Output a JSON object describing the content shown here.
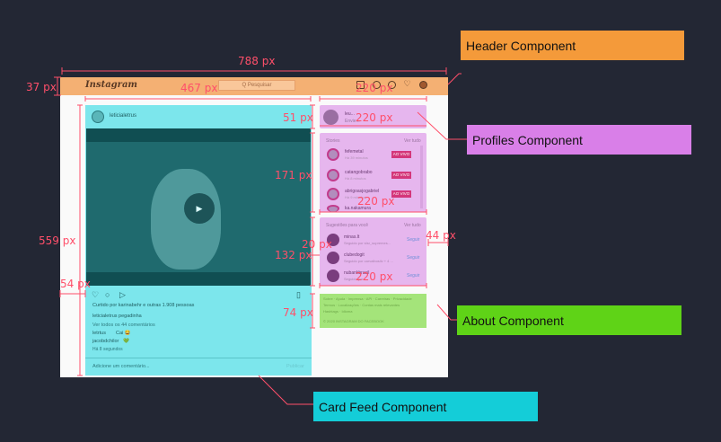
{
  "dimensions": {
    "page_width": "788 px",
    "header_height": "37 px",
    "feed_width": "467 px",
    "sidebar_width_header": "220 px",
    "profile_height": "51 px",
    "profile_width": "220 px",
    "stories_height": "171 px",
    "stories_width": "220 px",
    "page_height": "559 px",
    "feed_margin": "54 px",
    "suggest_gap": "20 px",
    "suggest_height": "132 px",
    "suggest_width": "220 px",
    "suggest_margin": "44 px",
    "about_height": "74 px"
  },
  "callouts": {
    "header": "Header Component",
    "profiles": "Profiles Component",
    "about": "About Component",
    "card_feed": "Card Feed Component"
  },
  "header": {
    "logo": "Instagram",
    "search": "Q Pesquisar"
  },
  "card": {
    "username": "leticialetrus",
    "liked_by": "Curtido por karinabehr e outras 1.908 pessoas",
    "caption": "leticialetrus pegadinha",
    "view_comments": "Ver todos os 44 comentários",
    "comment1_user": "letrtus",
    "comment1_text": "Cai 😂",
    "comment2_user": "jacobdchilor",
    "comment2_text": "💚",
    "time": "Há 8 segundos",
    "add_comment": "Adicione um comentário...",
    "publish": "Publicar"
  },
  "profile": {
    "username": "leu...",
    "subtitle": "Envie..."
  },
  "stories": {
    "title": "Stories",
    "see_all": "Ver tudo",
    "items": [
      {
        "name": "fefemetal",
        "time": "Há 39 minutos",
        "badge": "AO VIVO"
      },
      {
        "name": "catangobrabo",
        "time": "Há 8 minutos",
        "badge": "AO VIVO"
      },
      {
        "name": "abrigoasjogabriel",
        "time": "Há 9 minutos",
        "badge": "AO VIVO"
      },
      {
        "name": "ka.nakamura",
        "time": "",
        "badge": ""
      }
    ]
  },
  "suggestions": {
    "title": "Sugestões para você",
    "see_all": "Ver tudo",
    "items": [
      {
        "name": "minas.lt",
        "sub": "Seguido por slsr_supremes...",
        "action": "Seguir"
      },
      {
        "name": "clubedogit",
        "sub": "Seguido por carvalbosilv + 4 ...",
        "action": "Seguir"
      },
      {
        "name": "nubankbrasil",
        "sub": "Seguido por...",
        "action": "Seguir"
      }
    ]
  },
  "about": {
    "line1": "Sobre · Ajuda · Imprensa · API · Carreiras · Privacidade",
    "line2": "Termos · Localizações · Contas mais relevantes",
    "line3": "Hashtags · Idioma",
    "line4": "© 2020 INSTAGRAM DO FACEBOOK"
  }
}
